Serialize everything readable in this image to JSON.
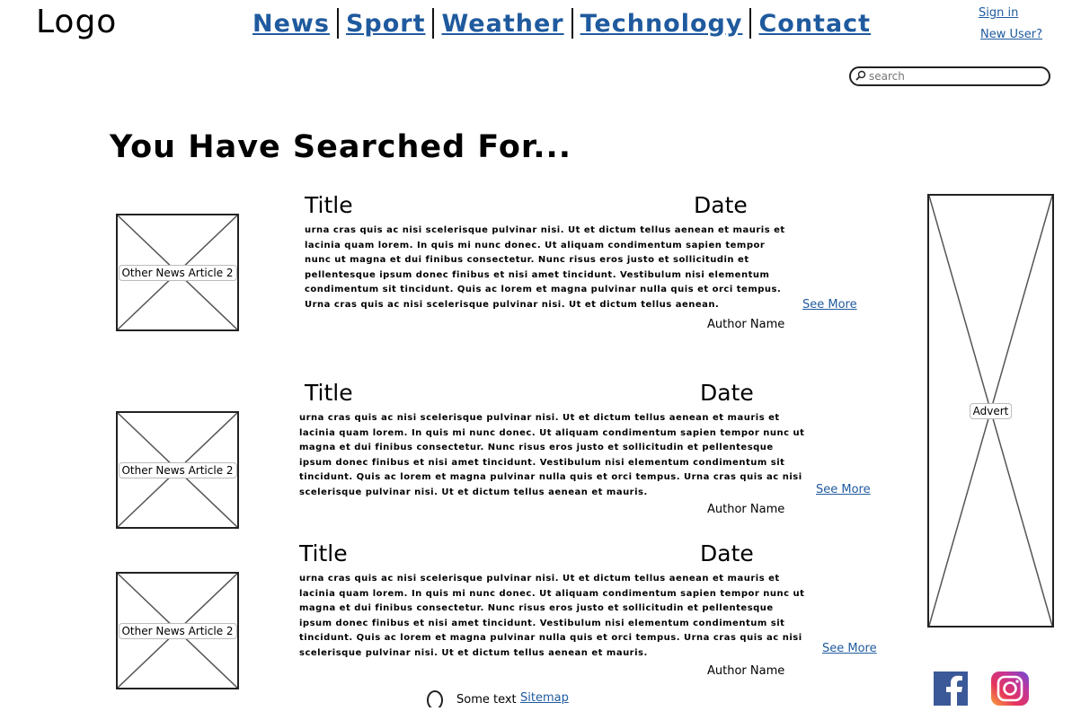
{
  "header": {
    "logo": "Logo",
    "nav": [
      "News",
      "Sport",
      "Weather",
      "Technology",
      "Contact"
    ],
    "sign_in": "Sign in",
    "new_user": "New User?"
  },
  "search": {
    "placeholder": "search"
  },
  "heading": "You Have Searched For...",
  "articles": [
    {
      "image_label": "Other News Article 2",
      "title": "Title",
      "date": "Date",
      "body": "urna cras quis ac nisi scelerisque pulvinar nisi. Ut et dictum tellus aenean et mauris et lacinia quam lorem. In quis mi nunc donec. Ut aliquam condimentum sapien tempor nunc ut magna et dui finibus consectetur. Nunc risus eros justo et sollicitudin et pellentesque ipsum donec finibus et nisi amet tincidunt. Vestibulum nisi elementum condimentum sit tincidunt. Quis ac lorem et magna pulvinar nulla quis et orci tempus. Urna cras quis ac nisi scelerisque pulvinar nisi. Ut et dictum tellus aenean.",
      "see_more": "See More",
      "author": "Author Name"
    },
    {
      "image_label": "Other News Article 2",
      "title": "Title",
      "date": "Date",
      "body": "urna cras quis ac nisi scelerisque pulvinar nisi. Ut et dictum tellus aenean et mauris et lacinia quam lorem. In quis mi nunc donec. Ut aliquam condimentum sapien tempor nunc ut magna et dui finibus consectetur. Nunc risus eros justo et sollicitudin et pellentesque ipsum donec finibus et nisi amet tincidunt. Vestibulum nisi elementum condimentum sit tincidunt. Quis ac lorem et magna pulvinar nulla quis et orci tempus. Urna cras quis ac nisi scelerisque pulvinar nisi. Ut et dictum tellus aenean et mauris.",
      "see_more": "See More",
      "author": "Author Name"
    },
    {
      "image_label": "Other News Article 2",
      "title": "Title",
      "date": "Date",
      "body": "urna cras quis ac nisi scelerisque pulvinar nisi. Ut et dictum tellus aenean et mauris et lacinia quam lorem. In quis mi nunc donec. Ut aliquam condimentum sapien tempor nunc ut magna et dui finibus consectetur. Nunc risus eros justo et sollicitudin et pellentesque ipsum donec finibus et nisi amet tincidunt. Vestibulum nisi elementum condimentum sit tincidunt. Quis ac lorem et magna pulvinar nulla quis et orci tempus. Urna cras quis ac nisi scelerisque pulvinar nisi. Ut et dictum tellus aenean et mauris.",
      "see_more": "See More",
      "author": "Author Name"
    }
  ],
  "advert": {
    "label": "Advert"
  },
  "footer": {
    "some_text": "Some text",
    "sitemap": "Sitemap"
  },
  "social": {
    "facebook": "facebook-icon",
    "instagram": "instagram-icon"
  }
}
